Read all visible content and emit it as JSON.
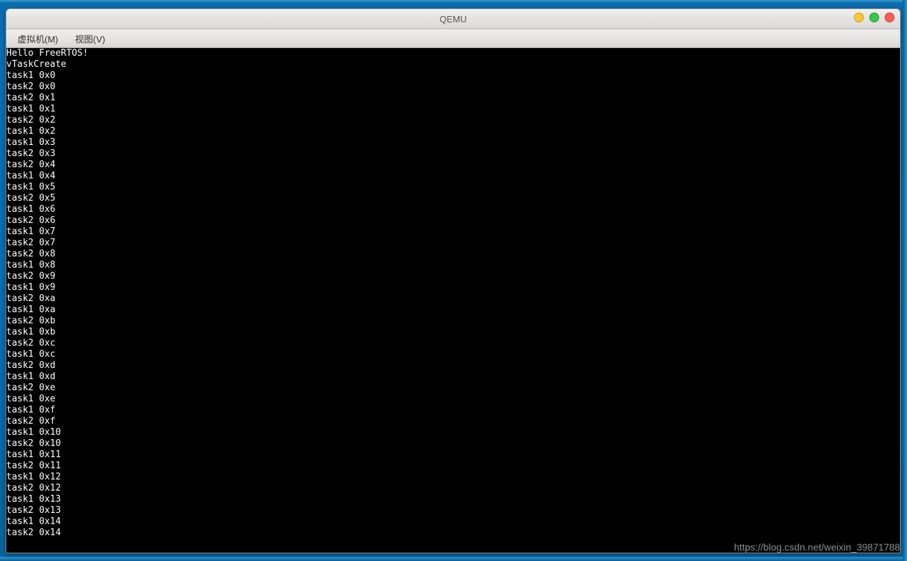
{
  "window": {
    "title": "QEMU"
  },
  "menu": {
    "vm": "虚拟机(M)",
    "view": "视图(V)"
  },
  "terminal": {
    "lines": [
      "Hello FreeRTOS!",
      "vTaskCreate",
      "task1 0x0",
      "task2 0x0",
      "task2 0x1",
      "task1 0x1",
      "task2 0x2",
      "task1 0x2",
      "task1 0x3",
      "task2 0x3",
      "task2 0x4",
      "task1 0x4",
      "task1 0x5",
      "task2 0x5",
      "task1 0x6",
      "task2 0x6",
      "task1 0x7",
      "task2 0x7",
      "task2 0x8",
      "task1 0x8",
      "task2 0x9",
      "task1 0x9",
      "task2 0xa",
      "task1 0xa",
      "task2 0xb",
      "task1 0xb",
      "task2 0xc",
      "task1 0xc",
      "task2 0xd",
      "task1 0xd",
      "task2 0xe",
      "task1 0xe",
      "task1 0xf",
      "task2 0xf",
      "task1 0x10",
      "task2 0x10",
      "task1 0x11",
      "task2 0x11",
      "task1 0x12",
      "task2 0x12",
      "task1 0x13",
      "task2 0x13",
      "task1 0x14",
      "task2 0x14"
    ]
  },
  "watermark": "https://blog.csdn.net/weixin_39871788"
}
